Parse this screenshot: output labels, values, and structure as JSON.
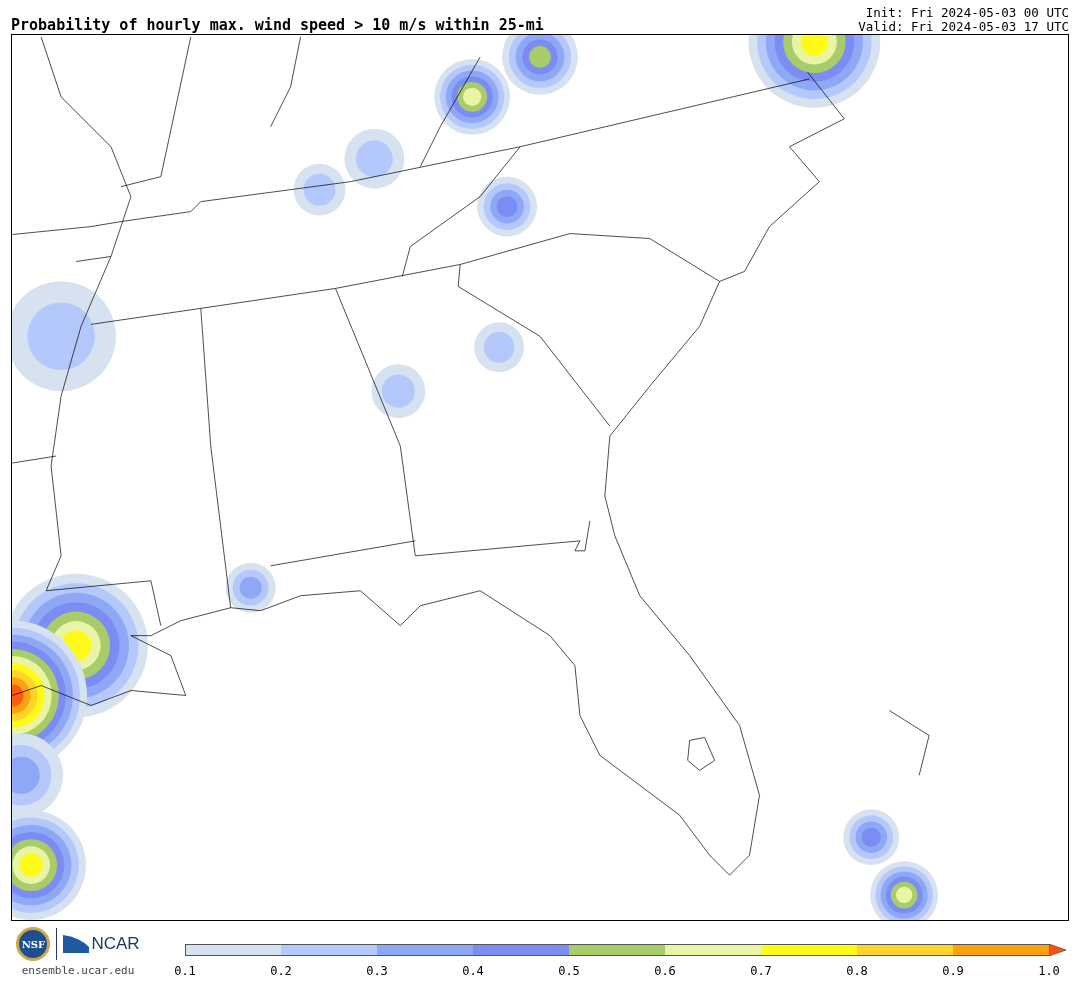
{
  "header": {
    "title": "Probability of hourly max. wind speed > 10 m/s within 25-mi",
    "init": "Init: Fri 2024-05-03 00 UTC",
    "valid": "Valid: Fri 2024-05-03 17 UTC"
  },
  "footer": {
    "nsf_logo": "NSF",
    "ncar_logo": "NCAR",
    "site": "ensemble.ucar.edu"
  },
  "colorbar": {
    "bins": [
      {
        "kind": "bin",
        "color": "#d6e2ef"
      },
      {
        "kind": "bin",
        "color": "#b5c8fb"
      },
      {
        "kind": "bin",
        "color": "#8fa8f6"
      },
      {
        "kind": "bin",
        "color": "#7b8df3"
      },
      {
        "kind": "bin",
        "color": "#a8cc6a"
      },
      {
        "kind": "bin",
        "color": "#e8f5a5"
      },
      {
        "kind": "bin",
        "color": "#fffa18"
      },
      {
        "kind": "bin",
        "color": "#ffd42a"
      },
      {
        "kind": "bin",
        "color": "#ffa010"
      },
      {
        "kind": "arrow",
        "color": "#ff5010"
      }
    ],
    "ticks": [
      "0.1",
      "0.2",
      "0.3",
      "0.4",
      "0.5",
      "0.6",
      "0.7",
      "0.8",
      "0.9",
      "1.0"
    ]
  }
}
